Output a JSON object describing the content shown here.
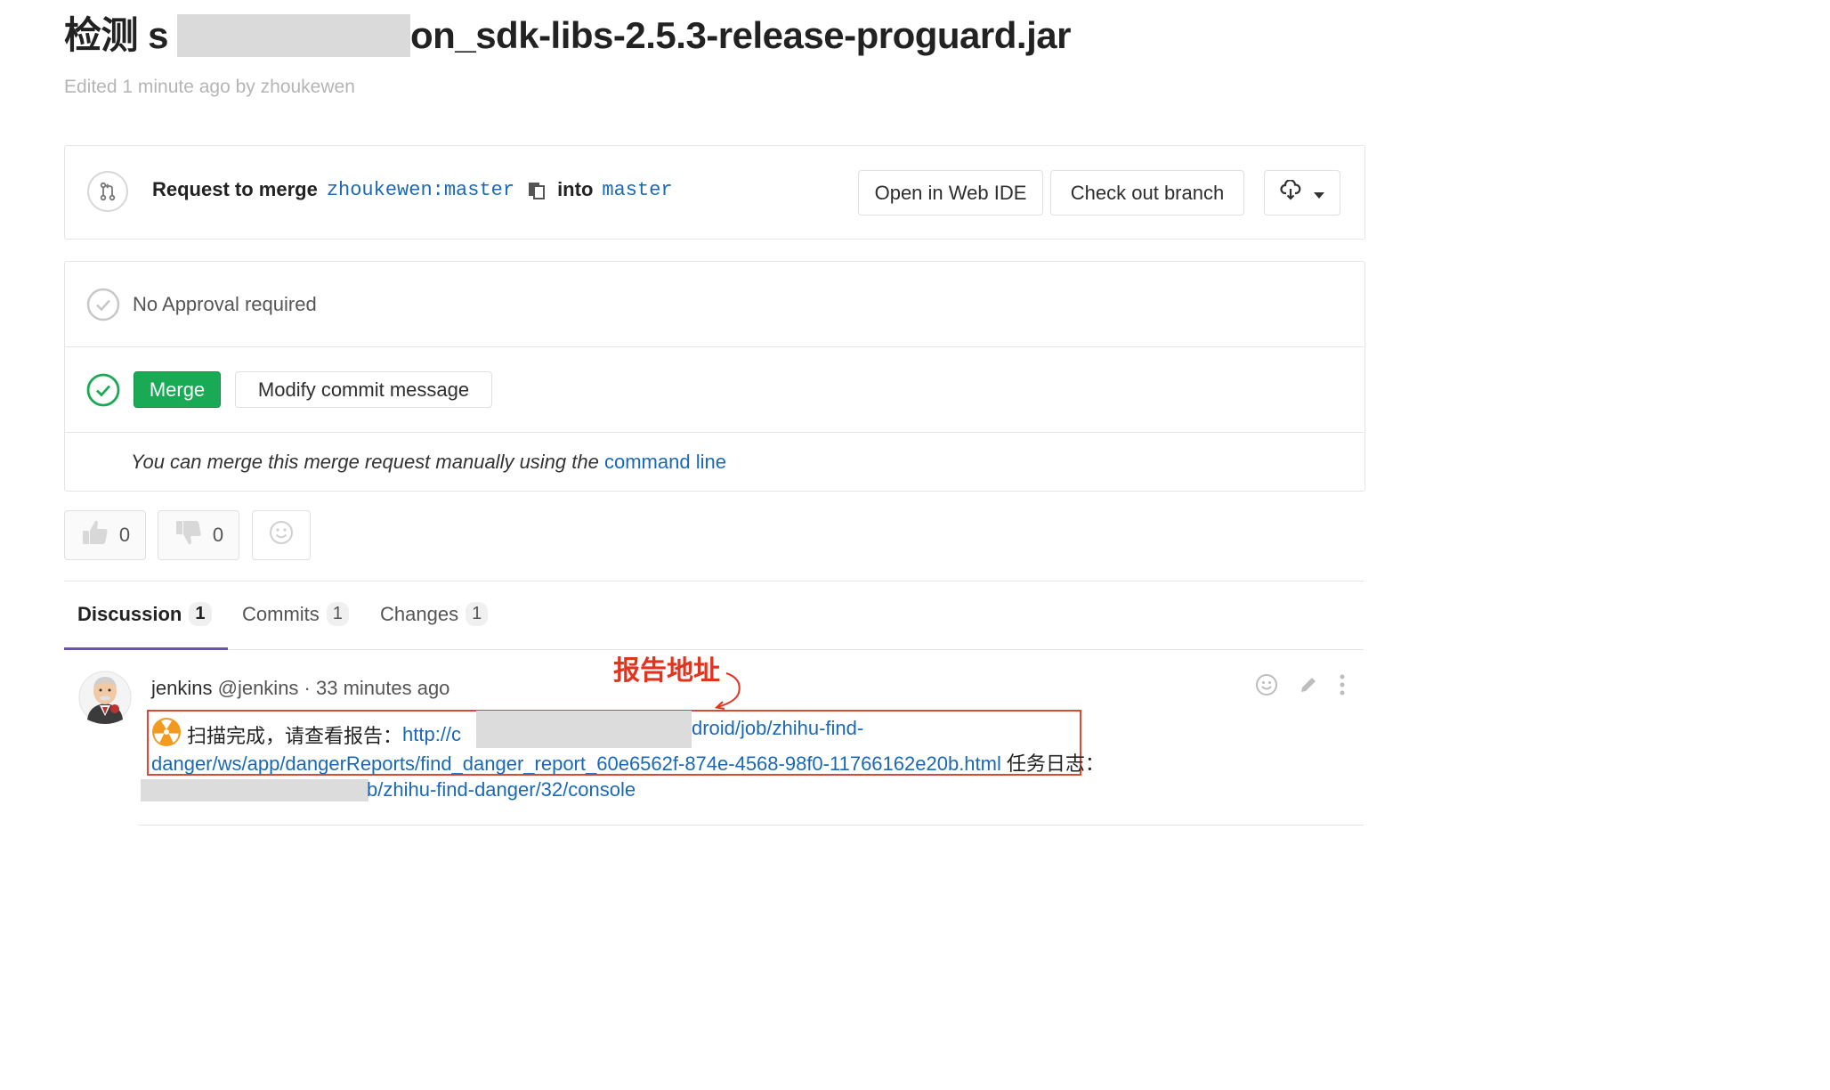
{
  "title": {
    "prefix": "检测 s",
    "suffix": "on_sdk-libs-2.5.3-release-proguard.jar"
  },
  "edited_text": "Edited 1 minute ago by zhoukewen",
  "merge_request": {
    "label": "Request to merge",
    "source_branch": "zhoukewen:master",
    "into_label": "into",
    "target_branch": "master",
    "open_ide_label": "Open in Web IDE",
    "checkout_label": "Check out branch"
  },
  "widget": {
    "approval_text": "No Approval required",
    "merge_label": "Merge",
    "modify_label": "Modify commit message",
    "cli_text": "You can merge this merge request manually using the",
    "cli_link": "command line"
  },
  "awards": {
    "thumbs_up": "0",
    "thumbs_down": "0"
  },
  "tabs": [
    {
      "label": "Discussion",
      "count": "1"
    },
    {
      "label": "Commits",
      "count": "1"
    },
    {
      "label": "Changes",
      "count": "1"
    }
  ],
  "note": {
    "author": "jenkins",
    "handle": "@jenkins",
    "time": " · 33 minutes ago",
    "scan_text": "扫描完成，请查看报告：",
    "link1_start": "http://c",
    "link1_end": "droid/job/zhihu-find-",
    "link1_line2": "danger/ws/app/dangerReports/find_danger_report_60e6562f-874e-4568-98f0-11766162e20b.html",
    "log_label": "任务日志：",
    "link2_end": "b/zhihu-find-danger/32/console"
  },
  "annotation": "报告地址",
  "colors": {
    "accent": "#6b4fbb",
    "link": "#1b69b6",
    "merge_green": "#1aaa55",
    "annotation_red": "#e03420"
  }
}
